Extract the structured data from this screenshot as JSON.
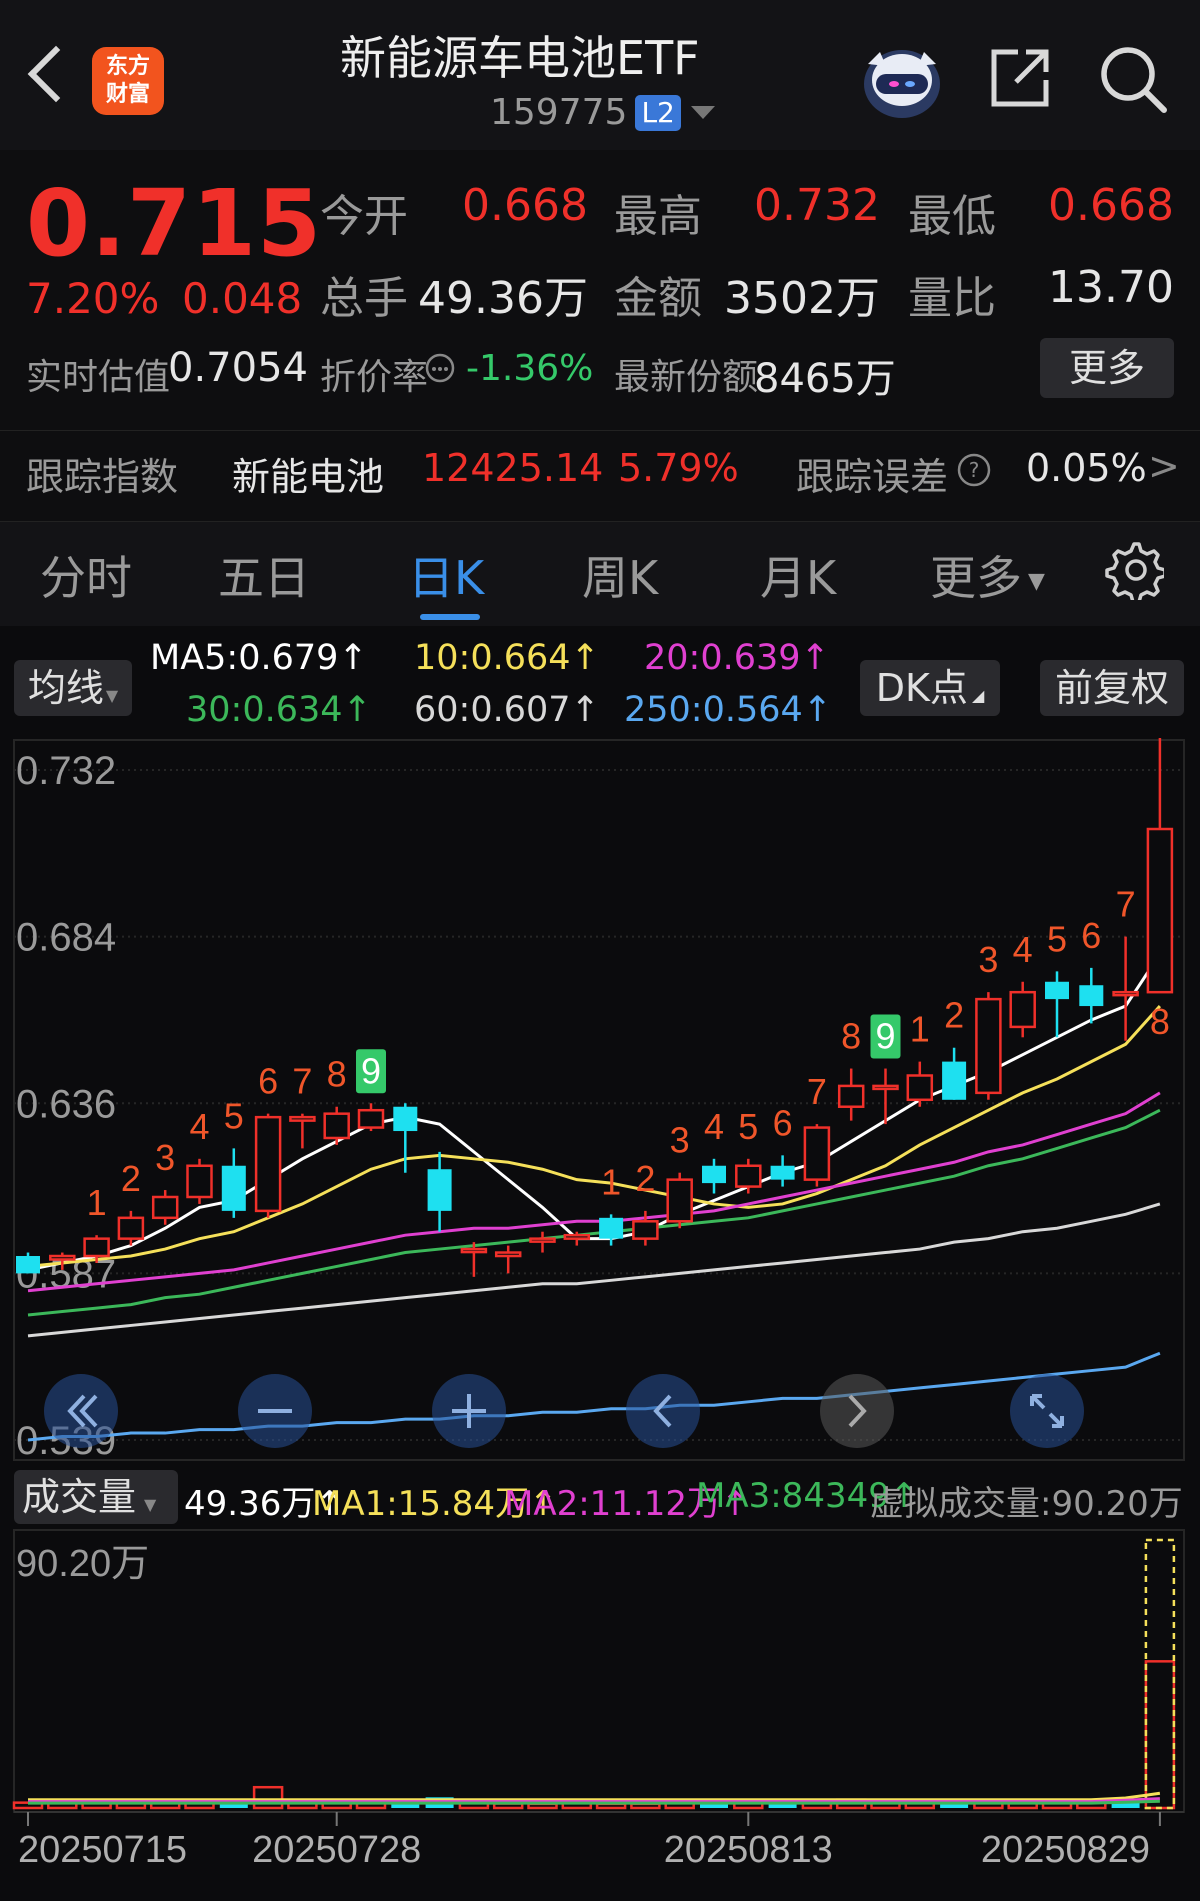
{
  "header": {
    "logo_text_1": "东方",
    "logo_text_2": "财富",
    "title": "新能源车电池ETF",
    "code": "159775",
    "level_badge": "L2",
    "icons": [
      "back-arrow-icon",
      "robot-avatar-icon",
      "share-icon",
      "search-icon"
    ]
  },
  "quote": {
    "price": "0.715",
    "change_pct": "7.20%",
    "change": "0.048",
    "open_label": "今开",
    "open": "0.668",
    "high_label": "最高",
    "high": "0.732",
    "low_label": "最低",
    "low": "0.668",
    "volume_label": "总手",
    "volume": "49.36万",
    "amount_label": "金额",
    "amount": "3502万",
    "ratio_label": "量比",
    "ratio": "13.70",
    "iopv_label": "实时估值",
    "iopv": "0.7054",
    "discount_label": "折价率",
    "discount": "-1.36%",
    "shares_label": "最新份额",
    "shares": "8465万",
    "more_label": "更多"
  },
  "tracking": {
    "label": "跟踪指数",
    "index_name": "新能电池",
    "index_value": "12425.14",
    "index_pct": "5.79%",
    "error_label": "跟踪误差",
    "error_value": "0.05%"
  },
  "tabs": [
    {
      "label": "分时"
    },
    {
      "label": "五日"
    },
    {
      "label": "日K",
      "active": true
    },
    {
      "label": "周K"
    },
    {
      "label": "月K"
    },
    {
      "label": "更多"
    }
  ],
  "ma_bar": {
    "selector": "均线",
    "ma5": "MA5:0.679↑",
    "ma10": "10:0.664↑",
    "ma20": "20:0.639↑",
    "ma30": "30:0.634↑",
    "ma60": "60:0.607↑",
    "ma250": "250:0.564↑",
    "dk_label": "DK点",
    "adjust_label": "前复权"
  },
  "colors": {
    "up": "#f0302a",
    "down": "#1ee0f0",
    "ma5": "#ffffff",
    "ma10": "#f5e05a",
    "ma20": "#e040d0",
    "ma30": "#3cb85a",
    "ma60": "#d8d8d8",
    "ma250": "#5aa8f0",
    "td_label_red": "#f0562a",
    "td_label_green": "#35c96a"
  },
  "volume_bar": {
    "selector": "成交量",
    "vol": "49.36万↑",
    "ma1": "MA1:15.84万↑",
    "ma2": "MA2:11.12万↑",
    "ma3": "MA3:84349↑",
    "virtual": "虚拟成交量:90.20万",
    "axis_top": "90.20万"
  },
  "chart_data": {
    "type": "candlestick",
    "y_ticks": [
      "0.732",
      "0.684",
      "0.636",
      "0.587",
      "0.539"
    ],
    "ylim": [
      0.539,
      0.732
    ],
    "x_labels": [
      "20250715",
      "20250728",
      "20250813",
      "20250829"
    ],
    "x_label_index": [
      0,
      9,
      21,
      33
    ],
    "candles": [
      {
        "o": 0.592,
        "h": 0.593,
        "l": 0.587,
        "c": 0.587
      },
      {
        "o": 0.591,
        "h": 0.593,
        "l": 0.588,
        "c": 0.592
      },
      {
        "o": 0.592,
        "h": 0.598,
        "l": 0.59,
        "c": 0.597
      },
      {
        "o": 0.597,
        "h": 0.605,
        "l": 0.595,
        "c": 0.603
      },
      {
        "o": 0.603,
        "h": 0.611,
        "l": 0.601,
        "c": 0.609
      },
      {
        "o": 0.609,
        "h": 0.62,
        "l": 0.607,
        "c": 0.618
      },
      {
        "o": 0.618,
        "h": 0.623,
        "l": 0.603,
        "c": 0.605
      },
      {
        "o": 0.605,
        "h": 0.633,
        "l": 0.603,
        "c": 0.632
      },
      {
        "o": 0.631,
        "h": 0.633,
        "l": 0.623,
        "c": 0.632
      },
      {
        "o": 0.626,
        "h": 0.635,
        "l": 0.624,
        "c": 0.633
      },
      {
        "o": 0.629,
        "h": 0.636,
        "l": 0.628,
        "c": 0.634
      },
      {
        "o": 0.635,
        "h": 0.636,
        "l": 0.616,
        "c": 0.628
      },
      {
        "o": 0.617,
        "h": 0.622,
        "l": 0.599,
        "c": 0.605
      },
      {
        "o": 0.594,
        "h": 0.596,
        "l": 0.586,
        "c": 0.594
      },
      {
        "o": 0.592,
        "h": 0.595,
        "l": 0.587,
        "c": 0.593
      },
      {
        "o": 0.597,
        "h": 0.599,
        "l": 0.593,
        "c": 0.597
      },
      {
        "o": 0.597,
        "h": 0.599,
        "l": 0.595,
        "c": 0.598
      },
      {
        "o": 0.603,
        "h": 0.604,
        "l": 0.595,
        "c": 0.597
      },
      {
        "o": 0.597,
        "h": 0.605,
        "l": 0.595,
        "c": 0.602
      },
      {
        "o": 0.602,
        "h": 0.616,
        "l": 0.6,
        "c": 0.614
      },
      {
        "o": 0.618,
        "h": 0.62,
        "l": 0.61,
        "c": 0.613
      },
      {
        "o": 0.612,
        "h": 0.62,
        "l": 0.61,
        "c": 0.618
      },
      {
        "o": 0.618,
        "h": 0.621,
        "l": 0.612,
        "c": 0.614
      },
      {
        "o": 0.614,
        "h": 0.63,
        "l": 0.612,
        "c": 0.629
      },
      {
        "o": 0.635,
        "h": 0.646,
        "l": 0.631,
        "c": 0.641
      },
      {
        "o": 0.641,
        "h": 0.646,
        "l": 0.63,
        "c": 0.641
      },
      {
        "o": 0.637,
        "h": 0.648,
        "l": 0.635,
        "c": 0.644
      },
      {
        "o": 0.648,
        "h": 0.652,
        "l": 0.637,
        "c": 0.637
      },
      {
        "o": 0.639,
        "h": 0.668,
        "l": 0.637,
        "c": 0.666
      },
      {
        "o": 0.658,
        "h": 0.671,
        "l": 0.655,
        "c": 0.668
      },
      {
        "o": 0.671,
        "h": 0.674,
        "l": 0.655,
        "c": 0.666
      },
      {
        "o": 0.67,
        "h": 0.675,
        "l": 0.659,
        "c": 0.664
      },
      {
        "o": 0.668,
        "h": 0.684,
        "l": 0.654,
        "c": 0.668
      },
      {
        "o": 0.668,
        "h": 0.745,
        "l": 0.668,
        "c": 0.715
      }
    ],
    "ma_series": [
      {
        "name": "MA5",
        "values": [
          0.588,
          0.59,
          0.592,
          0.595,
          0.6,
          0.606,
          0.608,
          0.614,
          0.62,
          0.625,
          0.63,
          0.632,
          0.63,
          0.622,
          0.614,
          0.606,
          0.597,
          0.597,
          0.599,
          0.604,
          0.608,
          0.612,
          0.616,
          0.619,
          0.625,
          0.631,
          0.637,
          0.641,
          0.645,
          0.65,
          0.655,
          0.66,
          0.664,
          0.679
        ]
      },
      {
        "name": "10",
        "values": [
          0.589,
          0.59,
          0.591,
          0.592,
          0.594,
          0.597,
          0.599,
          0.603,
          0.607,
          0.612,
          0.617,
          0.62,
          0.621,
          0.62,
          0.619,
          0.617,
          0.614,
          0.613,
          0.611,
          0.609,
          0.607,
          0.606,
          0.607,
          0.61,
          0.614,
          0.618,
          0.624,
          0.629,
          0.634,
          0.639,
          0.643,
          0.648,
          0.653,
          0.664
        ]
      },
      {
        "name": "20",
        "values": [
          0.582,
          0.583,
          0.584,
          0.585,
          0.586,
          0.587,
          0.588,
          0.59,
          0.592,
          0.594,
          0.596,
          0.598,
          0.599,
          0.6,
          0.6,
          0.601,
          0.602,
          0.602,
          0.603,
          0.604,
          0.605,
          0.607,
          0.609,
          0.611,
          0.613,
          0.615,
          0.617,
          0.619,
          0.622,
          0.624,
          0.627,
          0.63,
          0.633,
          0.639
        ]
      },
      {
        "name": "30",
        "values": [
          0.575,
          0.576,
          0.577,
          0.578,
          0.58,
          0.581,
          0.583,
          0.585,
          0.587,
          0.589,
          0.591,
          0.593,
          0.594,
          0.595,
          0.596,
          0.597,
          0.598,
          0.599,
          0.6,
          0.601,
          0.602,
          0.603,
          0.605,
          0.607,
          0.609,
          0.611,
          0.613,
          0.615,
          0.618,
          0.62,
          0.623,
          0.626,
          0.629,
          0.634
        ]
      },
      {
        "name": "60",
        "values": [
          0.569,
          0.57,
          0.571,
          0.572,
          0.573,
          0.574,
          0.575,
          0.576,
          0.577,
          0.578,
          0.579,
          0.58,
          0.581,
          0.582,
          0.583,
          0.584,
          0.584,
          0.585,
          0.586,
          0.587,
          0.588,
          0.589,
          0.59,
          0.591,
          0.592,
          0.593,
          0.594,
          0.596,
          0.597,
          0.599,
          0.6,
          0.602,
          0.604,
          0.607
        ]
      },
      {
        "name": "250",
        "values": [
          0.539,
          0.54,
          0.54,
          0.541,
          0.541,
          0.542,
          0.542,
          0.543,
          0.543,
          0.544,
          0.544,
          0.545,
          0.545,
          0.546,
          0.546,
          0.547,
          0.547,
          0.548,
          0.548,
          0.549,
          0.549,
          0.55,
          0.551,
          0.551,
          0.552,
          0.553,
          0.554,
          0.555,
          0.556,
          0.557,
          0.558,
          0.559,
          0.56,
          0.564
        ]
      }
    ],
    "td_labels": [
      {
        "i": 2,
        "t": "1",
        "pos": "above",
        "color": "red"
      },
      {
        "i": 3,
        "t": "2",
        "pos": "above",
        "color": "red"
      },
      {
        "i": 4,
        "t": "3",
        "pos": "above",
        "color": "red"
      },
      {
        "i": 5,
        "t": "4",
        "pos": "above",
        "color": "red"
      },
      {
        "i": 6,
        "t": "5",
        "pos": "above",
        "color": "red"
      },
      {
        "i": 7,
        "t": "6",
        "pos": "above",
        "color": "red"
      },
      {
        "i": 8,
        "t": "7",
        "pos": "above",
        "color": "red"
      },
      {
        "i": 9,
        "t": "8",
        "pos": "above",
        "color": "red"
      },
      {
        "i": 10,
        "t": "9",
        "pos": "above",
        "color": "green"
      },
      {
        "i": 17,
        "t": "1",
        "pos": "above",
        "color": "red"
      },
      {
        "i": 18,
        "t": "2",
        "pos": "above",
        "color": "red"
      },
      {
        "i": 19,
        "t": "3",
        "pos": "above",
        "color": "red"
      },
      {
        "i": 20,
        "t": "4",
        "pos": "above",
        "color": "red"
      },
      {
        "i": 21,
        "t": "5",
        "pos": "above",
        "color": "red"
      },
      {
        "i": 22,
        "t": "6",
        "pos": "above",
        "color": "red"
      },
      {
        "i": 23,
        "t": "7",
        "pos": "above",
        "color": "red"
      },
      {
        "i": 24,
        "t": "8",
        "pos": "above",
        "color": "red"
      },
      {
        "i": 25,
        "t": "9",
        "pos": "above",
        "color": "green"
      },
      {
        "i": 26,
        "t": "1",
        "pos": "above",
        "color": "red"
      },
      {
        "i": 27,
        "t": "2",
        "pos": "above",
        "color": "red"
      },
      {
        "i": 28,
        "t": "3",
        "pos": "above",
        "color": "red"
      },
      {
        "i": 29,
        "t": "4",
        "pos": "above",
        "color": "red"
      },
      {
        "i": 30,
        "t": "5",
        "pos": "above",
        "color": "red"
      },
      {
        "i": 31,
        "t": "6",
        "pos": "above",
        "color": "red"
      },
      {
        "i": 32,
        "t": "7",
        "pos": "above",
        "color": "red"
      },
      {
        "i": 33,
        "t": "8",
        "pos": "below",
        "color": "red"
      }
    ],
    "volume": {
      "ylim": [
        0,
        902000
      ],
      "values": [
        18000,
        17000,
        21000,
        20000,
        22000,
        22000,
        18000,
        70000,
        20000,
        22000,
        22000,
        18000,
        36000,
        20000,
        15000,
        14000,
        16000,
        14000,
        14000,
        18000,
        25000,
        20000,
        24000,
        20000,
        28000,
        22000,
        18000,
        24000,
        21000,
        24000,
        18000,
        22000,
        25000,
        493600
      ],
      "virtual_last": 902000,
      "up": [
        true,
        true,
        true,
        true,
        true,
        true,
        false,
        true,
        true,
        true,
        true,
        false,
        false,
        true,
        true,
        true,
        true,
        true,
        true,
        true,
        false,
        true,
        false,
        true,
        true,
        true,
        true,
        false,
        true,
        true,
        true,
        true,
        false,
        true
      ]
    }
  },
  "overlay_buttons": [
    "double-left-icon",
    "zoom-out-icon",
    "zoom-in-icon",
    "pan-left-icon",
    "pan-right-icon",
    "fullscreen-icon"
  ]
}
